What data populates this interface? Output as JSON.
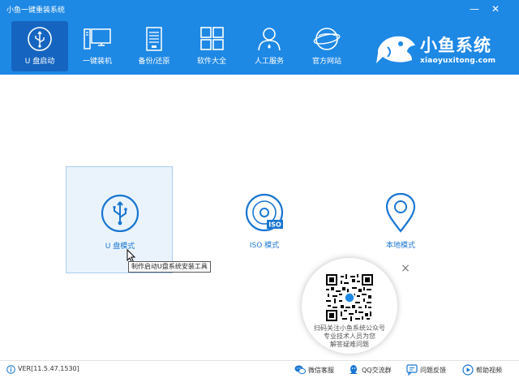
{
  "app": {
    "title": "小鱼一键重装系统"
  },
  "window_controls": {
    "minimize": "—",
    "close": "✕"
  },
  "nav": {
    "items": [
      {
        "label": "U 盘启动",
        "icon": "usb-icon",
        "active": true
      },
      {
        "label": "一键装机",
        "icon": "computer-icon",
        "active": false
      },
      {
        "label": "备份/还原",
        "icon": "backup-icon",
        "active": false
      },
      {
        "label": "软件大全",
        "icon": "apps-grid-icon",
        "active": false
      },
      {
        "label": "人工服务",
        "icon": "support-person-icon",
        "active": false
      },
      {
        "label": "官方网站",
        "icon": "globe-icon",
        "active": false
      }
    ]
  },
  "logo": {
    "name": "小鱼系统",
    "url": "xiaoyuxitong.com",
    "icon": "fish-logo-icon"
  },
  "modes": [
    {
      "label": "U 盘模式",
      "icon": "usb-circle-icon",
      "selected": true
    },
    {
      "label": "ISO 模式",
      "icon": "iso-disc-icon",
      "selected": false
    },
    {
      "label": "本地模式",
      "icon": "location-pin-icon",
      "selected": false
    }
  ],
  "tooltip": {
    "text": "制作启动U盘系统安装工具"
  },
  "qr_popup": {
    "close": "×",
    "lines": [
      "扫码关注小鱼系统公众号",
      "专业技术人员为您",
      "解答疑难问题"
    ]
  },
  "footer": {
    "version": "VER[11.5.47.1530]",
    "buttons": [
      {
        "label": "微信客服",
        "icon": "wechat-icon"
      },
      {
        "label": "QQ交流群",
        "icon": "qq-icon"
      },
      {
        "label": "问题反馈",
        "icon": "feedback-icon"
      },
      {
        "label": "帮助视频",
        "icon": "help-video-icon"
      }
    ]
  },
  "colors": {
    "header": "#1e88e5",
    "header_active": "#1565c0",
    "accent": "#1976d2"
  }
}
